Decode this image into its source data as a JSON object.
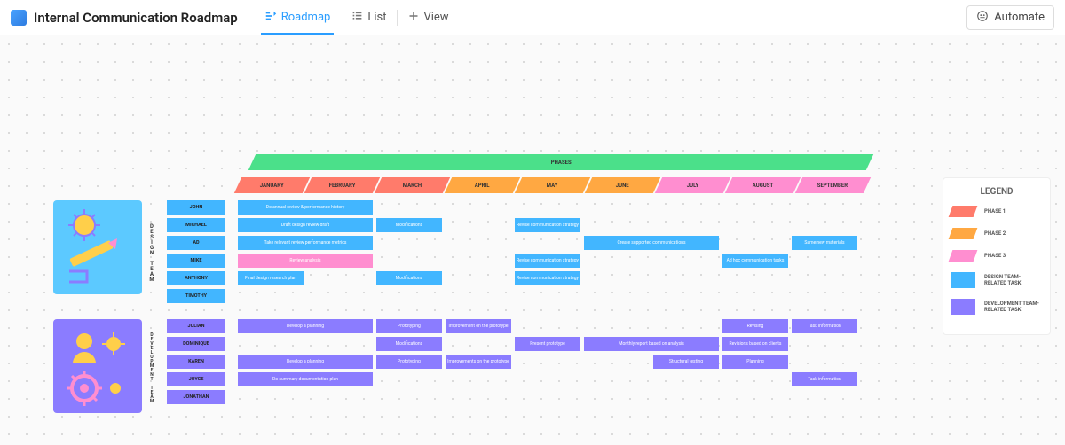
{
  "header": {
    "title": "Internal Communication Roadmap",
    "tabs": [
      {
        "icon": "roadmap-icon",
        "label": "Roadmap",
        "active": true
      },
      {
        "icon": "list-icon",
        "label": "List",
        "active": false
      },
      {
        "icon": "plus-icon",
        "label": "View",
        "active": false
      }
    ],
    "automate": "Automate"
  },
  "phases_band": "PHASES",
  "months": [
    "JANUARY",
    "FEBRUARY",
    "MARCH",
    "APRIL",
    "MAY",
    "JUNE",
    "JULY",
    "AUGUST",
    "SEPTEMBER"
  ],
  "month_colors": [
    "c-coral",
    "c-coral",
    "c-coral",
    "c-orange",
    "c-orange",
    "c-orange",
    "c-pink",
    "c-pink",
    "c-pink"
  ],
  "design_team": {
    "label": "DESIGN TEAM",
    "names": [
      "JOHN",
      "MICHAEL",
      "AD",
      "MIKE",
      "ANTHONY",
      "TIMOTHY"
    ],
    "rows": [
      [
        {
          "start": 0,
          "span": 2,
          "cls": "c-blue",
          "text": "Do annual review & performance history"
        }
      ],
      [
        {
          "start": 0,
          "span": 2,
          "cls": "c-blue",
          "text": "Draft design review draft"
        },
        {
          "start": 2,
          "span": 1,
          "cls": "c-blue",
          "text": "Modifications"
        },
        {
          "start": 4,
          "span": 1,
          "cls": "c-blue",
          "text": "Revise communication strategy"
        }
      ],
      [
        {
          "start": 0,
          "span": 2,
          "cls": "c-blue",
          "text": "Take relevant review performance metrics"
        },
        {
          "start": 5,
          "span": 2,
          "cls": "c-blue",
          "text": "Create supported communications"
        },
        {
          "start": 8,
          "span": 1,
          "cls": "c-blue",
          "text": "Same new materials"
        }
      ],
      [
        {
          "start": 0,
          "span": 2,
          "cls": "c-pink",
          "text": "Review analysis"
        },
        {
          "start": 4,
          "span": 1,
          "cls": "c-blue",
          "text": "Revise communication strategy"
        },
        {
          "start": 7,
          "span": 1,
          "cls": "c-blue",
          "text": "Ad hoc communication tasks"
        }
      ],
      [
        {
          "start": 0,
          "span": 1,
          "cls": "c-blue",
          "text": "Final design research plan"
        },
        {
          "start": 2,
          "span": 1,
          "cls": "c-blue",
          "text": "Modifications"
        },
        {
          "start": 4,
          "span": 1,
          "cls": "c-blue",
          "text": "Revise communication strategy"
        }
      ],
      []
    ]
  },
  "dev_team": {
    "label": "DEVELOPMENT TEAM",
    "names": [
      "JULIAN",
      "DOMINIQUE",
      "KAREN",
      "JOYCE",
      "JONATHAN"
    ],
    "rows": [
      [
        {
          "start": 0,
          "span": 2,
          "cls": "c-purple",
          "text": "Develop a planning"
        },
        {
          "start": 2,
          "span": 1,
          "cls": "c-purple",
          "text": "Prototyping"
        },
        {
          "start": 3,
          "span": 1,
          "cls": "c-purple",
          "text": "Improvement on the prototype"
        },
        {
          "start": 7,
          "span": 1,
          "cls": "c-purple",
          "text": "Revising"
        },
        {
          "start": 8,
          "span": 1,
          "cls": "c-purple",
          "text": "Task information"
        }
      ],
      [
        {
          "start": 2,
          "span": 1,
          "cls": "c-purple",
          "text": "Modifications"
        },
        {
          "start": 4,
          "span": 1,
          "cls": "c-purple",
          "text": "Present prototype"
        },
        {
          "start": 5,
          "span": 2,
          "cls": "c-purple",
          "text": "Monthly report based on analysis"
        },
        {
          "start": 7,
          "span": 1,
          "cls": "c-purple",
          "text": "Revisions based on clients"
        }
      ],
      [
        {
          "start": 0,
          "span": 2,
          "cls": "c-purple",
          "text": "Develop a planning"
        },
        {
          "start": 2,
          "span": 1,
          "cls": "c-purple",
          "text": "Prototyping"
        },
        {
          "start": 3,
          "span": 1,
          "cls": "c-purple",
          "text": "Improvements on the prototype"
        },
        {
          "start": 6,
          "span": 1,
          "cls": "c-purple",
          "text": "Structural testing"
        },
        {
          "start": 7,
          "span": 1,
          "cls": "c-purple",
          "text": "Planning"
        }
      ],
      [
        {
          "start": 0,
          "span": 2,
          "cls": "c-purple",
          "text": "Do summary documentation plan"
        },
        {
          "start": 8,
          "span": 1,
          "cls": "c-purple",
          "text": "Task information"
        }
      ],
      []
    ]
  },
  "legend": {
    "title": "LEGEND",
    "items": [
      {
        "cls": "c-coral",
        "label": "PHASE 1",
        "skew": true
      },
      {
        "cls": "c-orange",
        "label": "PHASE 2",
        "skew": true
      },
      {
        "cls": "c-pink",
        "label": "PHASE 3",
        "skew": true
      },
      {
        "cls": "c-blue",
        "label": "DESIGN TEAM-RELATED TASK",
        "skew": false
      },
      {
        "cls": "c-purple",
        "label": "DEVELOPMENT TEAM-RELATED TASK",
        "skew": false
      }
    ]
  }
}
